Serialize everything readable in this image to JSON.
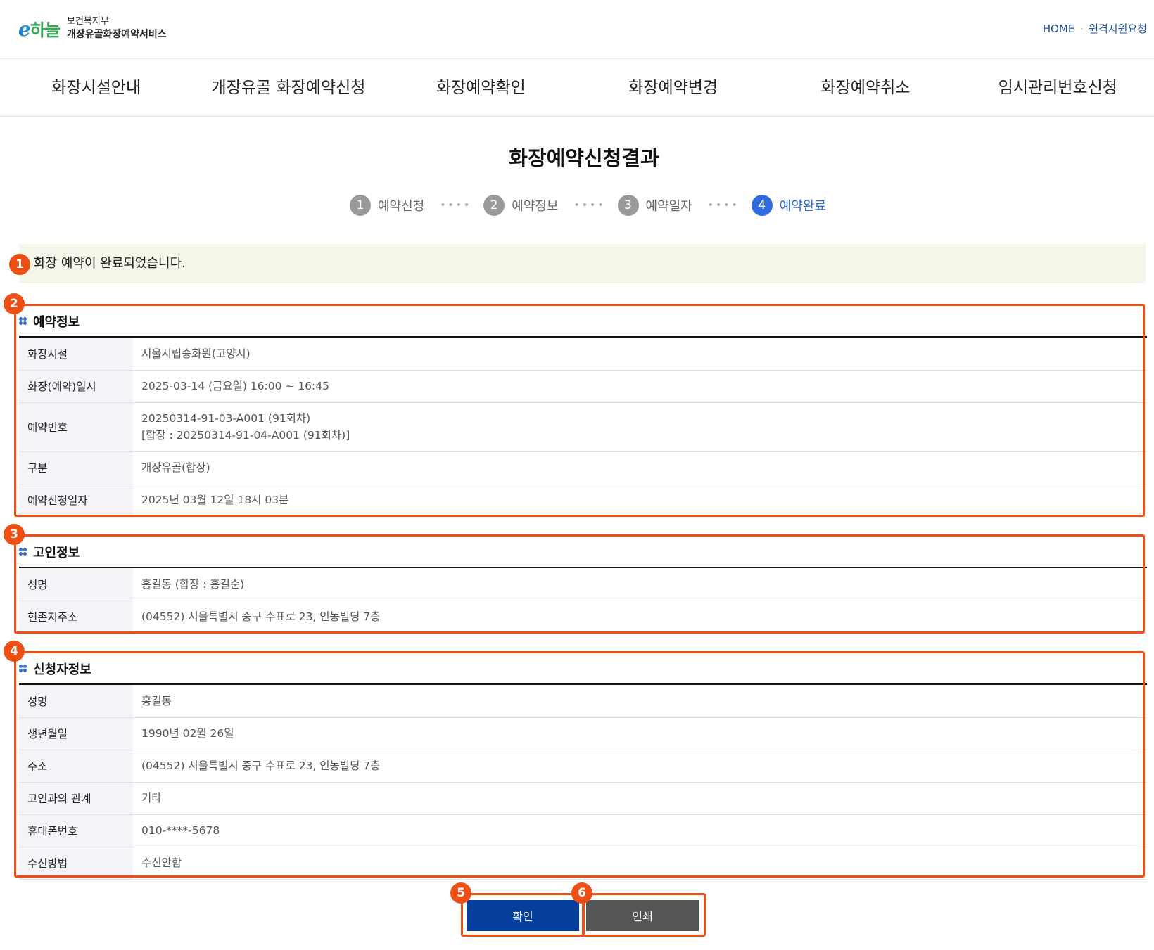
{
  "header": {
    "logo_mark": "e",
    "logo_mark_accent": "하늘",
    "ministry": "보건복지부",
    "service_name": "개장유골화장예약서비스",
    "util_links": [
      "HOME",
      "원격지원요청"
    ]
  },
  "gnb": [
    "화장시설안내",
    "개장유골 화장예약신청",
    "화장예약확인",
    "화장예약변경",
    "화장예약취소",
    "임시관리번호신청"
  ],
  "page_title": "화장예약신청결과",
  "steps": [
    {
      "num": "1",
      "label": "예약신청"
    },
    {
      "num": "2",
      "label": "예약정보"
    },
    {
      "num": "3",
      "label": "예약일자"
    },
    {
      "num": "4",
      "label": "예약완료"
    }
  ],
  "notice": "화장 예약이 완료되었습니다.",
  "reservation": {
    "title": "예약정보",
    "rows": [
      {
        "label": "화장시설",
        "value": "서울시립승화원(고양시)"
      },
      {
        "label": "화장(예약)일시",
        "value": "2025-03-14 (금요일) 16:00 ~ 16:45"
      },
      {
        "label": "예약번호",
        "value": "20250314-91-03-A001 (91회차)",
        "value2": "[합장 : 20250314-91-04-A001 (91회차)]"
      },
      {
        "label": "구분",
        "value": "개장유골(합장)"
      },
      {
        "label": "예약신청일자",
        "value": "2025년 03월 12일 18시 03분"
      }
    ]
  },
  "deceased": {
    "title": "고인정보",
    "rows": [
      {
        "label": "성명",
        "value": "홍길동 (합장 : 홍길순)"
      },
      {
        "label": "현존지주소",
        "value": "(04552) 서울특별시 중구 수표로 23, 인농빌딩 7층"
      }
    ]
  },
  "applicant": {
    "title": "신청자정보",
    "rows": [
      {
        "label": "성명",
        "value": "홍길동"
      },
      {
        "label": "생년월일",
        "value": "1990년 02월 26일"
      },
      {
        "label": "주소",
        "value": "(04552) 서울특별시 중구 수표로 23, 인농빌딩 7층"
      },
      {
        "label": "고인과의 관계",
        "value": "기타"
      },
      {
        "label": "휴대폰번호",
        "value": "010-****-5678"
      },
      {
        "label": "수신방법",
        "value": "수신안함"
      }
    ]
  },
  "buttons": {
    "confirm": "확인",
    "print": "인쇄"
  },
  "annotations": [
    "1",
    "2",
    "3",
    "4",
    "5",
    "6"
  ],
  "colors": {
    "primary_blue": "#053f9b",
    "step_active": "#2f6bdc",
    "annotation": "#ee4f14",
    "notice_bg": "#f3f7ea",
    "print_button": "#555555"
  }
}
